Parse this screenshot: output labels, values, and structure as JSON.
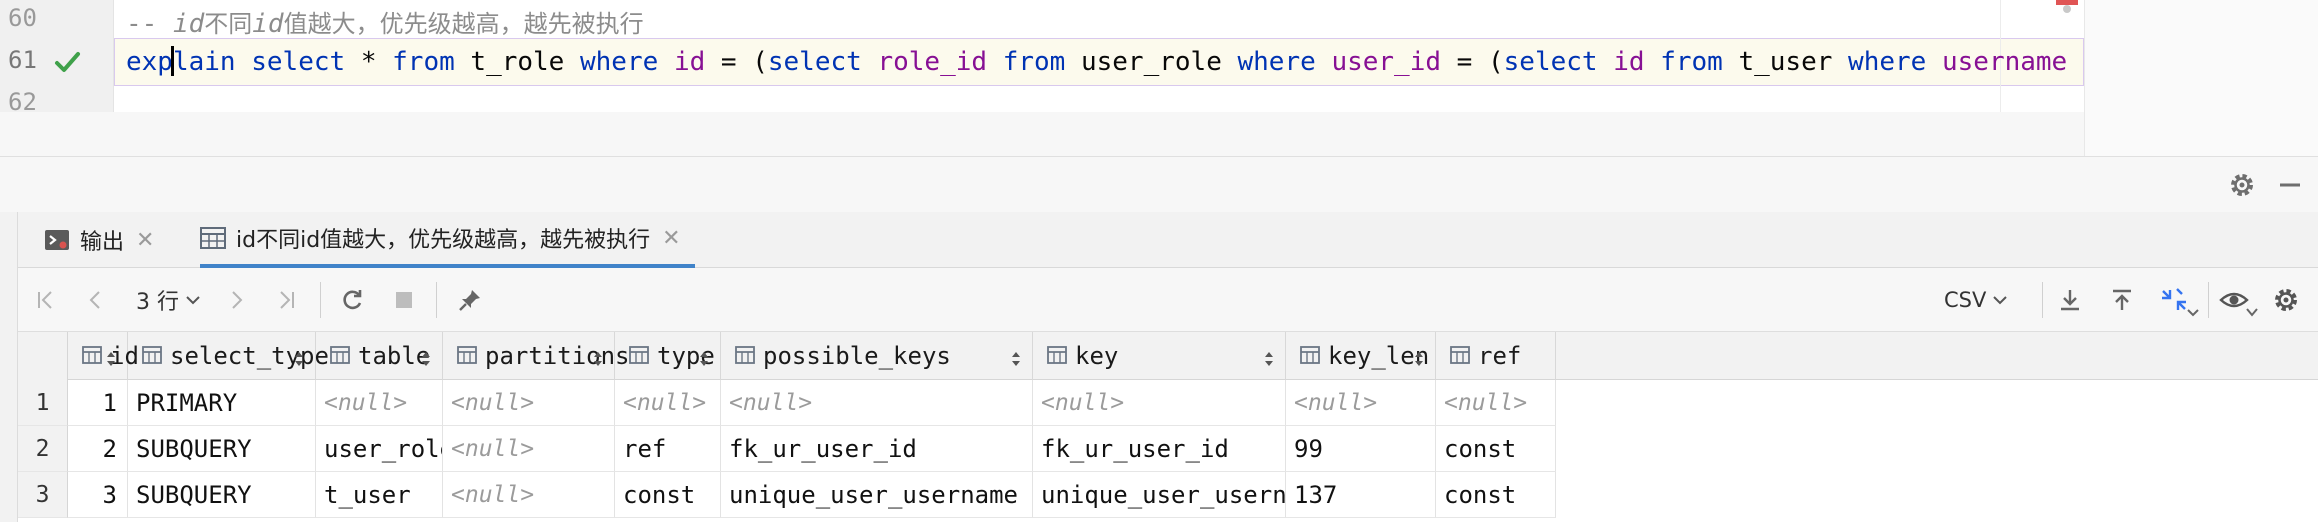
{
  "editor": {
    "lines": [
      {
        "number": "60",
        "comment_prefix": "-- ",
        "comment_id_1": "id",
        "comment_mid": "不同",
        "comment_id_2": "id",
        "comment_rest": "值越大，优先级越高，越先被执行"
      },
      {
        "number": "61",
        "status_icon": "check-icon",
        "tokens": [
          "exp",
          "lain",
          " ",
          "select",
          " * ",
          "from",
          " t_role ",
          "where",
          " ",
          "id",
          " = (",
          "select",
          " ",
          "role_id",
          " ",
          "from",
          " user_role ",
          "where",
          " ",
          "user_id",
          " = (",
          "select",
          " ",
          "id",
          " ",
          "from",
          " t_user ",
          "where",
          " ",
          "username",
          " ="
        ]
      },
      {
        "number": "62"
      }
    ]
  },
  "tabs": [
    {
      "label": "输出",
      "icon": "console-icon"
    },
    {
      "label": "id不同id值越大，优先级越高，越先被执行",
      "icon": "table-icon"
    }
  ],
  "toolbar": {
    "rows": "3 行",
    "export_format": "CSV"
  },
  "grid": {
    "columns": [
      "id",
      "select_type",
      "table",
      "partitions",
      "type",
      "possible_keys",
      "key",
      "key_len",
      "ref"
    ],
    "rows": [
      {
        "row": "1",
        "cells": [
          "1",
          "PRIMARY",
          "<null>",
          "<null>",
          "<null>",
          "<null>",
          "<null>",
          "<null>",
          "<null>"
        ]
      },
      {
        "row": "2",
        "cells": [
          "2",
          "SUBQUERY",
          "user_role",
          "<null>",
          "ref",
          "fk_ur_user_id",
          "fk_ur_user_id",
          "99",
          "const"
        ]
      },
      {
        "row": "3",
        "cells": [
          "3",
          "SUBQUERY",
          "t_user",
          "<null>",
          "const",
          "unique_user_username",
          "unique_user_username",
          "137",
          "const"
        ]
      }
    ]
  },
  "colors": {
    "keyword": "#0033b3",
    "column": "#871094",
    "check": "#3fa14a",
    "tab_underline": "#4083c9",
    "null_text": "#9b9b9b"
  }
}
